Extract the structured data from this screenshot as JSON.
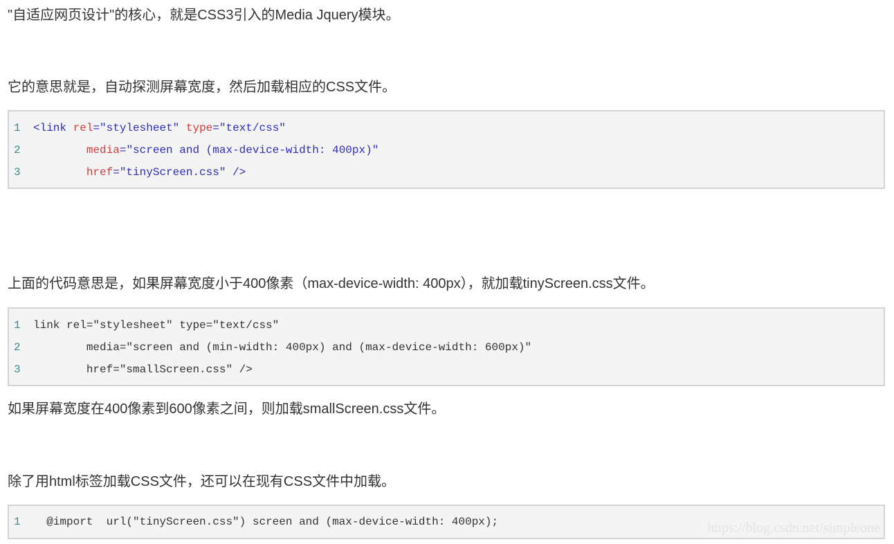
{
  "paragraphs": {
    "p1": "\"自适应网页设计\"的核心，就是CSS3引入的Media Jquery模块。",
    "p2": "它的意思就是，自动探测屏幕宽度，然后加载相应的CSS文件。",
    "p3": "上面的代码意思是，如果屏幕宽度小于400像素（max-device-width: 400px），就加载tinyScreen.css文件。",
    "p4": "如果屏幕宽度在400像素到600像素之间，则加载smallScreen.css文件。",
    "p5": "除了用html标签加载CSS文件，还可以在现有CSS文件中加载。"
  },
  "code1": {
    "line1": {
      "num": "1",
      "t1": "<link",
      "a1": "rel",
      "e1": "=",
      "s1": "\"stylesheet\"",
      "a2": "type",
      "e2": "=",
      "s2": "\"text/css\""
    },
    "line2": {
      "num": "2",
      "a1": "media",
      "e1": "=",
      "s1": "\"screen and (max-device-width: 400px)\""
    },
    "line3": {
      "num": "3",
      "a1": "href",
      "e1": "=",
      "s1": "\"tinyScreen.css\"",
      "t1": "/>"
    }
  },
  "code2": {
    "line1": {
      "num": "1",
      "text": "link rel=\"stylesheet\" type=\"text/css\""
    },
    "line2": {
      "num": "2",
      "text": "media=\"screen and (min-width: 400px) and (max-device-width: 600px)\""
    },
    "line3": {
      "num": "3",
      "text": "href=\"smallScreen.css\" />"
    }
  },
  "code3": {
    "line1": {
      "num": "1",
      "text": "@import  url(\"tinyScreen.css\") screen and (max-device-width: 400px);"
    }
  },
  "watermark": "https://blog.csdn.net/simpleone",
  "colors": {
    "text": "#333333",
    "code_bg": "#f4f4f4",
    "code_border": "#d4d4d4",
    "line_number": "#3a8a8a",
    "tag": "#2d2db4",
    "attribute": "#d23b3b",
    "string": "#2d2db4"
  }
}
